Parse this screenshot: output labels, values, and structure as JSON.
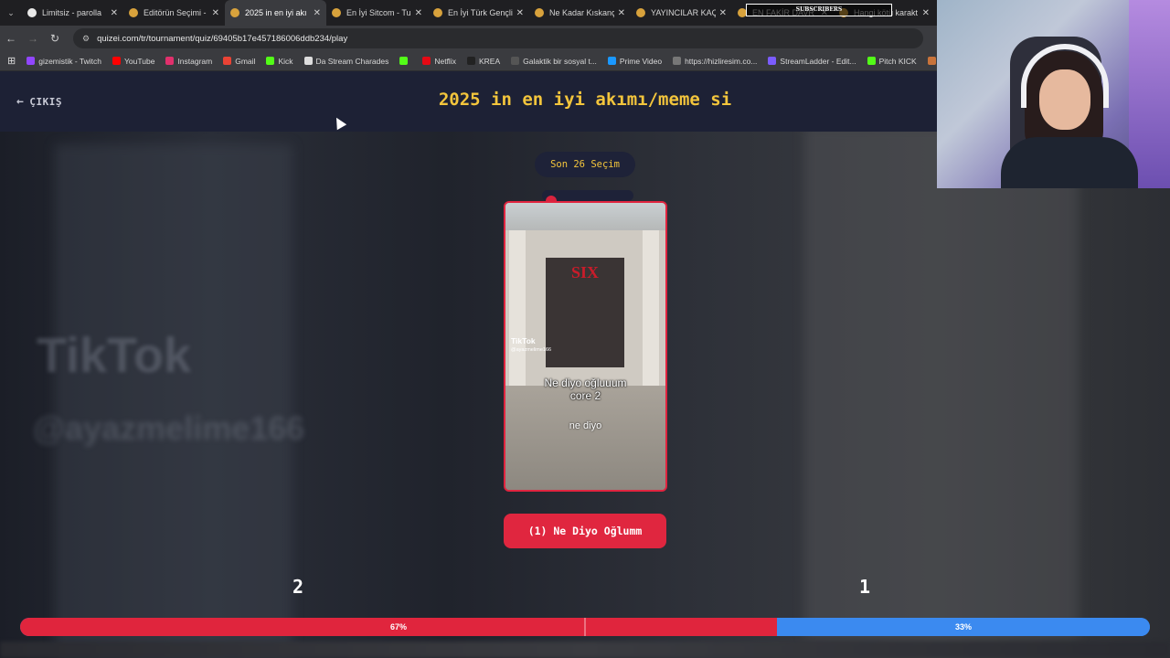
{
  "browser": {
    "tabs": [
      {
        "title": "Limitsiz - parolla",
        "active": false,
        "icon": "white"
      },
      {
        "title": "Editörün Seçimi -",
        "active": false,
        "icon": "yellow"
      },
      {
        "title": "2025 in en iyi akı",
        "active": true,
        "icon": "yellow"
      },
      {
        "title": "En İyi Sitcom - Tu",
        "active": false,
        "icon": "yellow"
      },
      {
        "title": "En İyi Türk Gençli",
        "active": false,
        "icon": "yellow"
      },
      {
        "title": "Ne Kadar Kıskanç",
        "active": false,
        "icon": "yellow"
      },
      {
        "title": "YAYINCILAR KAÇ",
        "active": false,
        "icon": "yellow"
      },
      {
        "title": "EN FAKİR DAVR",
        "active": false,
        "icon": "yellow"
      },
      {
        "title": "Hangi kötü karakt",
        "active": false,
        "icon": "yellow"
      }
    ],
    "overlay_text": "SUBSCRIBERS",
    "url": "quizei.com/tr/tournament/quiz/69405b17e457186006ddb234/play",
    "bookmarks": [
      {
        "label": "gizemistik - Twitch",
        "color": "#9146ff"
      },
      {
        "label": "YouTube",
        "color": "#ff0000"
      },
      {
        "label": "Instagram",
        "color": "#e1306c"
      },
      {
        "label": "Gmail",
        "color": "#ea4335"
      },
      {
        "label": "Kick",
        "color": "#53fc18"
      },
      {
        "label": "Da Stream Charades",
        "color": "#dddddd"
      },
      {
        "label": "",
        "color": "#53fc18"
      },
      {
        "label": "Netflix",
        "color": "#e50914"
      },
      {
        "label": "KREA",
        "color": "#222222"
      },
      {
        "label": "Galaktik bir sosyal t...",
        "color": "#555555"
      },
      {
        "label": "Prime Video",
        "color": "#1a98ff"
      },
      {
        "label": "https://hizliresim.co...",
        "color": "#777777"
      },
      {
        "label": "StreamLadder - Edit...",
        "color": "#7b5cff"
      },
      {
        "label": "Pitch KICK",
        "color": "#53fc18"
      },
      {
        "label": "Ben Bild",
        "color": "#c8733a"
      }
    ]
  },
  "page": {
    "exit_label": "ÇIKIŞ",
    "title": "2025 in en iyi akımı/meme si",
    "round_label": "Son 26 Seçim",
    "card": {
      "tiktok_mark": "TikTok",
      "tiktok_handle": "@ayazmelime166",
      "store_logo": "SIX",
      "caption_line1": "Ne diyo oğluuum",
      "caption_line2": "core 2",
      "caption_sub": "ne diyo"
    },
    "bg_tiktok": "TikTok",
    "bg_handle": "@ayazmelime166",
    "choice_button": "(1) Ne Diyo Oğlumm",
    "score_left": "2",
    "score_right": "1",
    "bar": {
      "left_percent": 67,
      "left_label": "67%",
      "right_label": "33%"
    }
  },
  "colors": {
    "accent_red": "#e0263f",
    "accent_blue": "#3b8af0",
    "title_yellow": "#f3c53c",
    "header_bg": "#1d2135"
  }
}
